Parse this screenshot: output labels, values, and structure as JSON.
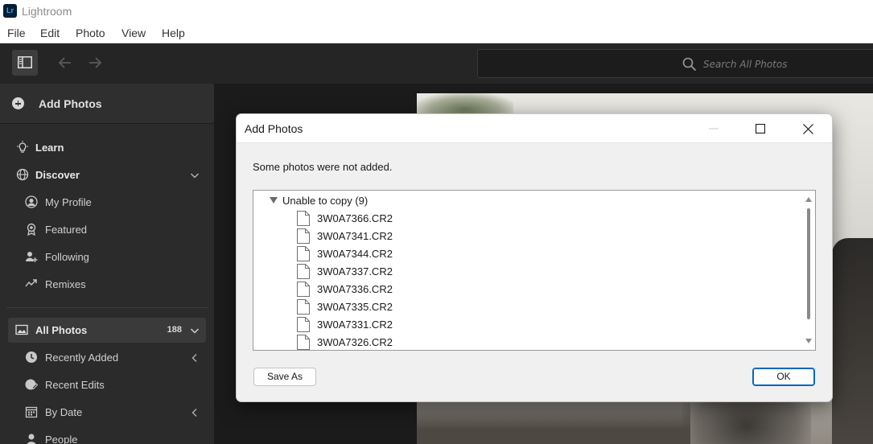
{
  "app": {
    "title": "Lightroom",
    "icon_label": "Lr"
  },
  "menu": [
    "File",
    "Edit",
    "Photo",
    "View",
    "Help"
  ],
  "toolbar": {
    "panel_icon": "panel-toggle-icon",
    "back_icon": "arrow-left-icon",
    "forward_icon": "arrow-right-icon",
    "search_placeholder": "Search All Photos"
  },
  "sidebar": {
    "add_photos": "Add Photos",
    "learn": "Learn",
    "discover": "Discover",
    "my_profile": "My Profile",
    "featured": "Featured",
    "following": "Following",
    "remixes": "Remixes",
    "all_photos": "All Photos",
    "all_photos_count": "188",
    "recently_added": "Recently Added",
    "recent_edits": "Recent Edits",
    "by_date": "By Date",
    "people": "People"
  },
  "dialog": {
    "title": "Add Photos",
    "message": "Some photos were not added.",
    "group_label": "Unable to copy (9)",
    "files": [
      "3W0A7366.CR2",
      "3W0A7341.CR2",
      "3W0A7344.CR2",
      "3W0A7337.CR2",
      "3W0A7336.CR2",
      "3W0A7335.CR2",
      "3W0A7331.CR2",
      "3W0A7326.CR2"
    ],
    "save_as": "Save As",
    "ok": "OK"
  },
  "colors": {
    "sidebar_bg": "#2b2b2b",
    "toolbar_bg": "#252525",
    "dialog_bg": "#f0f0f0",
    "accent_blue": "#0067c0"
  }
}
